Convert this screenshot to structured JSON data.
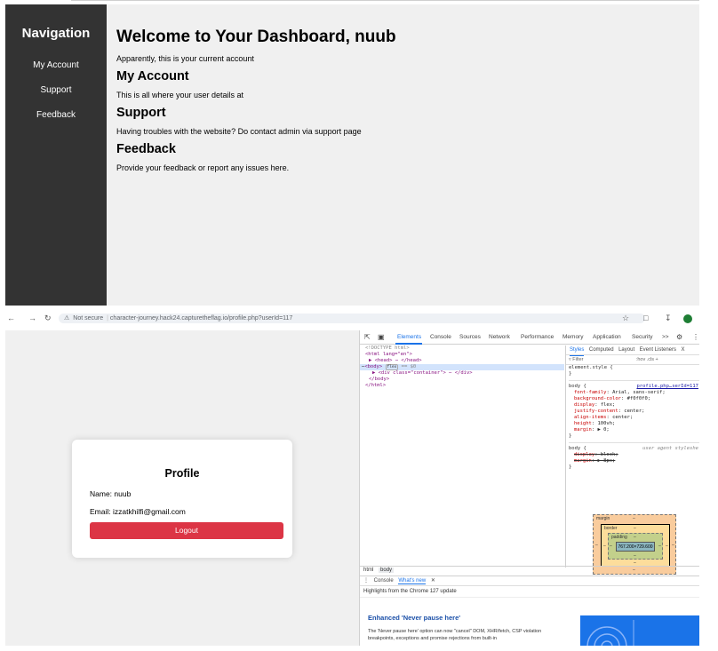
{
  "dashboard": {
    "nav_title": "Navigation",
    "nav_items": [
      "My Account",
      "Support",
      "Feedback"
    ],
    "heading": "Welcome to Your Dashboard, nuub",
    "intro": "Apparently, this is your current account",
    "sections": [
      {
        "title": "My Account",
        "text": "This is all where your user details at"
      },
      {
        "title": "Support",
        "text": "Having troubles with the website? Do contact admin via support page"
      },
      {
        "title": "Feedback",
        "text": "Provide your feedback or report any issues here."
      }
    ]
  },
  "browser": {
    "security": "Not secure",
    "url": "character-journey.hack24.capturetheflag.io/profile.php?userId=117"
  },
  "profile": {
    "title": "Profile",
    "name_line": "Name: nuub",
    "email_line": "Email: izzatkhilfi@gmail.com",
    "logout_label": "Logout"
  },
  "devtools": {
    "tabs": [
      "Elements",
      "Console",
      "Sources",
      "Network",
      "Performance",
      "Memory",
      "Application",
      "Security",
      ">>"
    ],
    "dom": {
      "doctype": "<!DOCTYPE html>",
      "html_open": "<html lang=\"en\">",
      "head": "▶ <head> ⋯ </head>",
      "body_open": "<body>",
      "body_badge": "flex",
      "body_eq": "== $0",
      "div": "▶ <div class=\"container\"> ⋯ </div>",
      "body_close": "</body>",
      "html_close": "</html>"
    },
    "styles_tabs": [
      "Styles",
      "Computed",
      "Layout",
      "Event Listeners",
      "X"
    ],
    "filter_placeholder": "Filter",
    "filter_tools": ":hov  .cls  +",
    "element_style": "element.style {",
    "close_brace": "}",
    "rule_selector": "body {",
    "rule_source": "profile.php…serId=117",
    "rule_props": [
      {
        "prop": "font-family",
        "val": "Arial, sans-serif;"
      },
      {
        "prop": "background-color",
        "val": "#f0f0f0;"
      },
      {
        "prop": "display",
        "val": "flex;"
      },
      {
        "prop": "justify-content",
        "val": "center;"
      },
      {
        "prop": "align-items",
        "val": "center;"
      },
      {
        "prop": "height",
        "val": "100vh;"
      },
      {
        "prop": "margin",
        "val": "▶ 0;"
      }
    ],
    "ua_selector": "body {",
    "ua_source": "user agent styleshe",
    "ua_props": [
      {
        "prop": "display",
        "val": "block;"
      },
      {
        "prop": "margin",
        "val": "▶ 8px;"
      }
    ],
    "box_model": {
      "margin_label": "margin",
      "border_label": "border",
      "padding_label": "padding",
      "content": "767.200×729.600",
      "dash": "–"
    },
    "crumbs": [
      "html",
      "body"
    ],
    "drawer_tabs": [
      "Console",
      "What's new"
    ],
    "drawer_close": "✕",
    "highlights": "Highlights from the Chrome 127 update",
    "feature_title": "Enhanced 'Never pause here'",
    "feature_body": "The 'Never pause here' option can now \"cancel\" DOM, XHR/fetch, CSP violation breakpoints, exceptions and promise rejections from built-in"
  },
  "colors": {
    "sidebar_bg": "#333333",
    "page_bg": "#f0f0f0",
    "logout_bg": "#dc3545",
    "devtools_accent": "#1a73e8"
  }
}
